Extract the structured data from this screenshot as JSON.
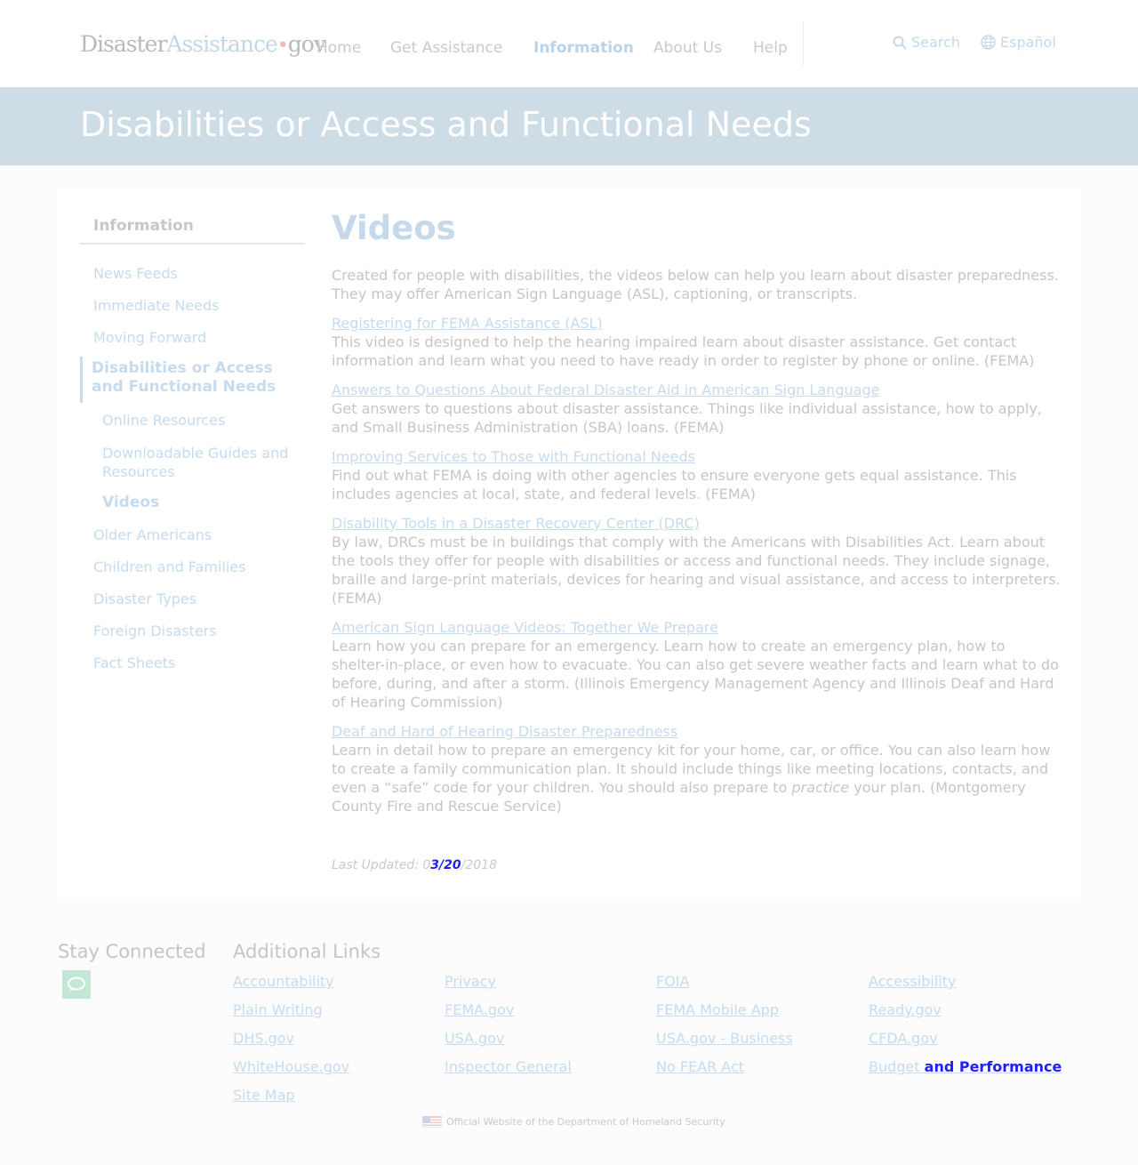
{
  "header": {
    "logo": {
      "part1": "Disaster",
      "part2": "Assistance",
      "dot": "•",
      "part3": "gov"
    },
    "nav": [
      "Home",
      "Get Assistance",
      "Information",
      "About Us",
      "Help"
    ],
    "search_label": "Search",
    "language_label": "Español"
  },
  "banner": {
    "title": "Disabilities or Access and Functional Needs"
  },
  "sidebar": {
    "title": "Information",
    "items": {
      "news_feeds": "News Feeds",
      "immediate_needs": "Immediate Needs",
      "moving_forward": "Moving Forward",
      "disabilities": "Disabilities or Access and Functional Needs",
      "online_resources": "Online Resources",
      "downloadable_guides": "Downloadable Guides and Resources",
      "videos": "Videos",
      "older_americans": "Older Americans",
      "children_families": "Children and Families",
      "disaster_types": "Disaster Types",
      "foreign_disasters": "Foreign Disasters",
      "fact_sheets": "Fact Sheets"
    }
  },
  "main": {
    "heading": "Videos",
    "intro": "Created for people with disabilities, the videos below can help you learn about disaster preparedness. They may offer American Sign Language (ASL), captioning, or transcripts.",
    "videos": [
      {
        "title": "Registering for FEMA Assistance (ASL)",
        "description": "This video is designed to help the hearing impaired learn about disaster assistance. Get contact information and learn what you need to have ready in order to register by phone or online. (FEMA)"
      },
      {
        "title": "Answers to Questions About Federal Disaster Aid in American Sign Language",
        "description": "Get answers to questions about disaster assistance. Things like individual assistance, how to apply, and Small Business Administration (SBA) loans. (FEMA)"
      },
      {
        "title": "Improving Services to Those with Functional Needs",
        "description": "Find out what FEMA is doing with other agencies to ensure everyone gets equal assistance. This includes agencies at local, state, and federal levels. (FEMA)"
      },
      {
        "title": "Disability Tools in a Disaster Recovery Center (DRC)",
        "description": "By law, DRCs must be in buildings that comply with the Americans with Disabilities Act. Learn about the tools they offer for people with disabilities or access and functional needs. They include signage, braille and large-print materials, devices for hearing and visual assistance, and access to interpreters. (FEMA)"
      },
      {
        "title": "American Sign Language Videos: Together We Prepare",
        "description": "Learn how you can prepare for an emergency. Learn how to create an emergency plan, how to shelter-in-place, or even how to evacuate. You can also get severe weather facts and learn what to do before, during, and after a storm. (Illinois Emergency Management Agency and Illinois Deaf and Hard of Hearing Commission)"
      },
      {
        "title": "Deaf and Hard of Hearing Disaster Preparedness",
        "description_before": "Learn in detail how to prepare an emergency kit for your home, car, or office. You can also learn how to create a family communication plan. It should include things like meeting locations, contacts, and even a “safe” code for your children. You should also prepare to ",
        "description_emphasis": "practice",
        "description_after": " your plan. (Montgomery County Fire and Rescue Service)"
      }
    ],
    "last_updated": {
      "prefix": "Last Updated: 0",
      "highlight": "3/20",
      "suffix": "/2018"
    }
  },
  "footer": {
    "stay_connected": "Stay Connected",
    "additional_links": "Additional Links",
    "links": {
      "accountability": "Accountability",
      "privacy": "Privacy",
      "foia": "FOIA",
      "accessibility": "Accessibility",
      "plain_writing": "Plain Writing",
      "fema": "FEMA.gov",
      "fema_mobile": "FEMA Mobile App",
      "ready": "Ready.gov",
      "dhs": "DHS.gov",
      "usa": "USA.gov",
      "usa_business": "USA.gov - Business",
      "cfda": "CFDA.gov",
      "whitehouse": "WhiteHouse.gov",
      "inspector_general": "Inspector General",
      "no_fear": "No FEAR Act",
      "budget_prefix": "Budget ",
      "budget_highlight": "and Performance",
      "site_map": "Site Map"
    },
    "dhs_notice": "Official Website of the Department of Homeland Security"
  }
}
